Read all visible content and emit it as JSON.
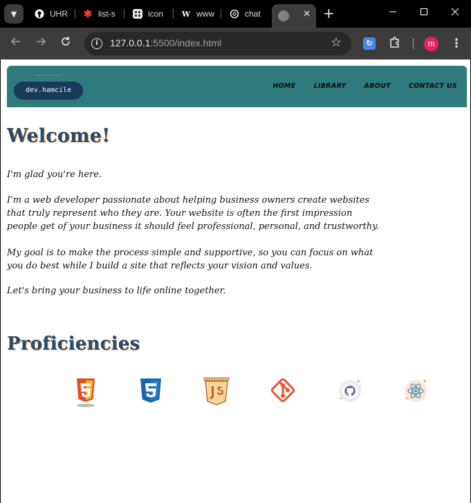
{
  "browser": {
    "tabs": [
      {
        "label": "UHR",
        "icon": "github-icon"
      },
      {
        "label": "list-s",
        "icon": "asterisk-icon"
      },
      {
        "label": "icon",
        "icon": "grid-icon"
      },
      {
        "label": "www",
        "icon": "w-icon"
      },
      {
        "label": "chat",
        "icon": "openai-icon"
      }
    ],
    "active_tab_close": "✕",
    "new_tab": "+",
    "url_host": "127.0.0.1",
    "url_rest": ":5500/index.html",
    "profile_initial": "m",
    "colors": {
      "tabstrip": "#000000",
      "toolbar": "#3c3c3c",
      "omnibox": "#282828",
      "avatar": "#e91e63"
    }
  },
  "site": {
    "logo": "dev.hamcile",
    "nav": [
      "HOME",
      "LIBRARY",
      "ABOUT",
      "CONTACT US"
    ],
    "welcome_heading": "Welcome!",
    "paragraphs": [
      "I'm glad you're here.",
      "I'm a web developer passionate about helping business owners create websites that truly represent who they are. Your website is often the first impression people get of your business it should feel professional, personal, and trustworthy.",
      "My goal is to make the process simple and supportive, so you can focus on what you do best while I build a site that reflects your vision and values.",
      "Let's bring your business to life online together."
    ],
    "proficiencies_heading": "Proficiencies",
    "skills": [
      "html5-icon",
      "css3-icon",
      "javascript-icon",
      "git-icon",
      "github-icon",
      "react-icon"
    ],
    "colors": {
      "header": "#2f7b7b",
      "logo_bg": "#17395a",
      "heading": "#2a4a6a",
      "heading_shadow": "#d68a3c"
    }
  }
}
